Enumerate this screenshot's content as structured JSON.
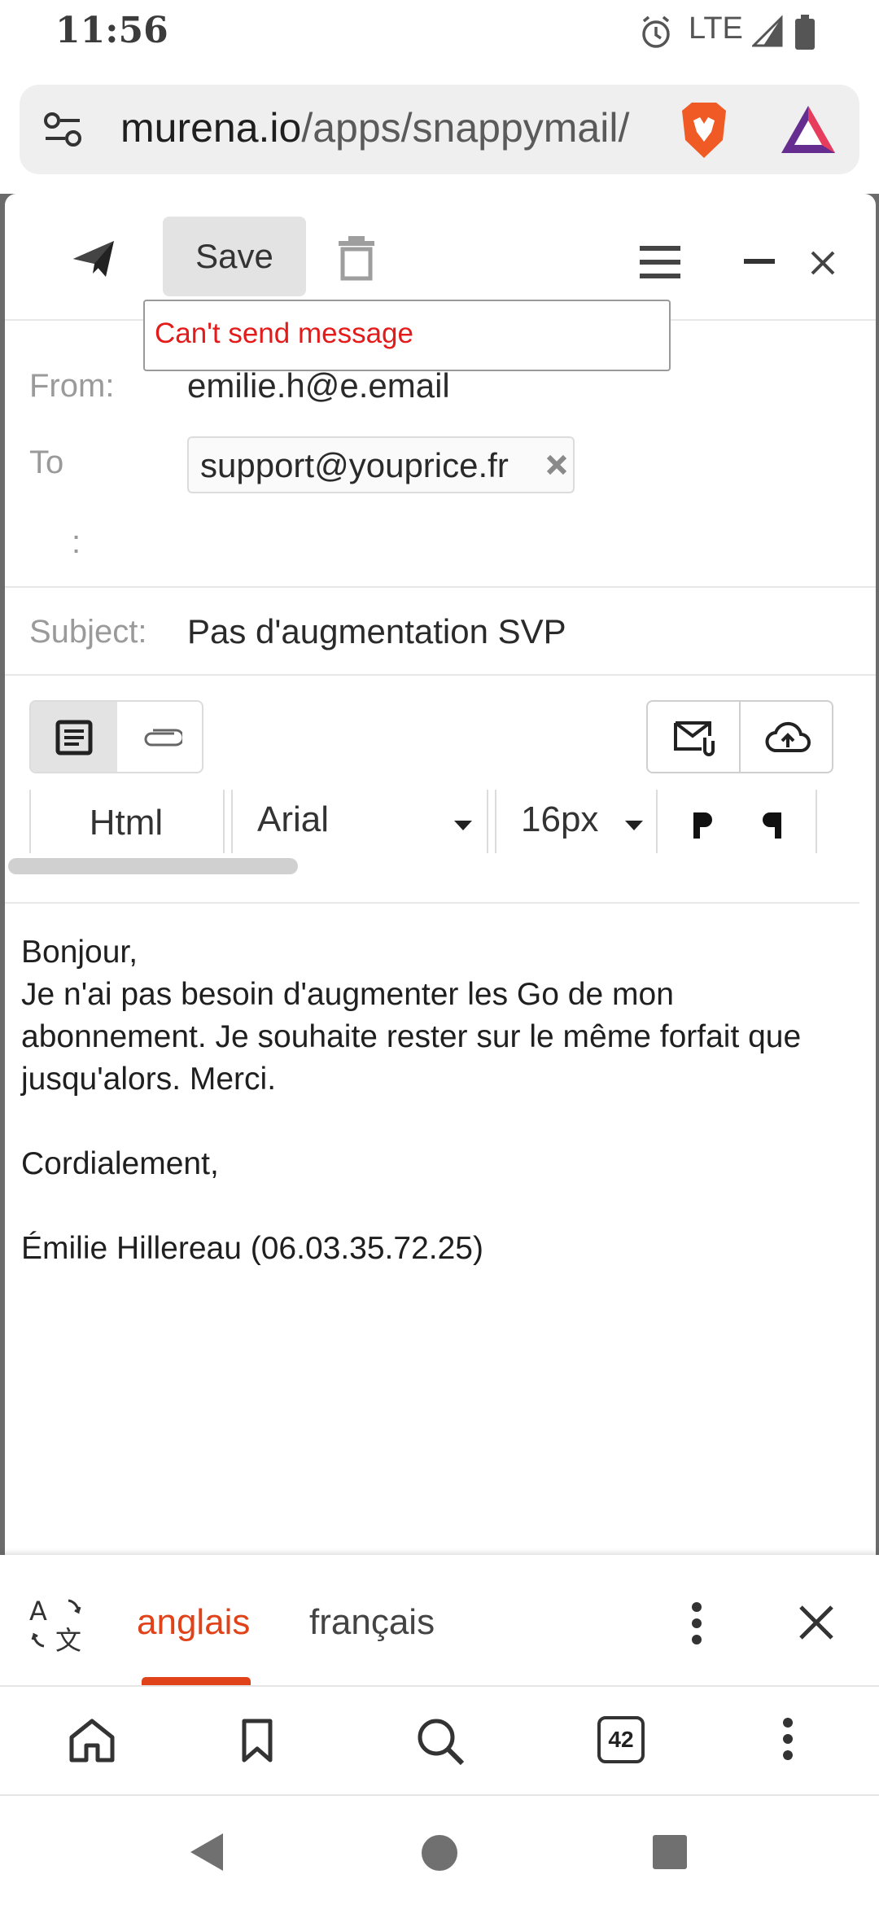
{
  "status_bar": {
    "time": "11:56",
    "network": "LTE"
  },
  "browser": {
    "url_host": "murena.io",
    "url_path": "/apps/snappymail/",
    "tabs_count": "42"
  },
  "compose": {
    "save_label": "Save",
    "error_tooltip": "Can't send message",
    "from_label": "From:",
    "from_value": "emilie.h@e.email",
    "to_label": "To",
    "to_recipient": "support@youprice.fr",
    "extra_label": ":",
    "subject_label": "Subject:",
    "subject_value": "Pas d'augmentation SVP",
    "format_mode": "Html",
    "font_family": "Arial",
    "font_size": "16px",
    "body_lines": [
      "Bonjour,",
      "Je n'ai pas besoin d'augmenter les Go de mon abonnement. Je souhaite rester sur le même forfait que jusqu'alors. Merci.",
      "",
      "Cordialement,",
      "",
      "Émilie Hillereau (06.03.35.72.25)"
    ]
  },
  "translate_bar": {
    "lang_source": "anglais",
    "lang_target": "français",
    "accent_color": "#e0431a"
  },
  "icons": {
    "send": "paper-plane-icon",
    "trash": "trash-icon",
    "menu": "hamburger-icon",
    "minimize": "minimize-icon",
    "close": "close-icon"
  }
}
